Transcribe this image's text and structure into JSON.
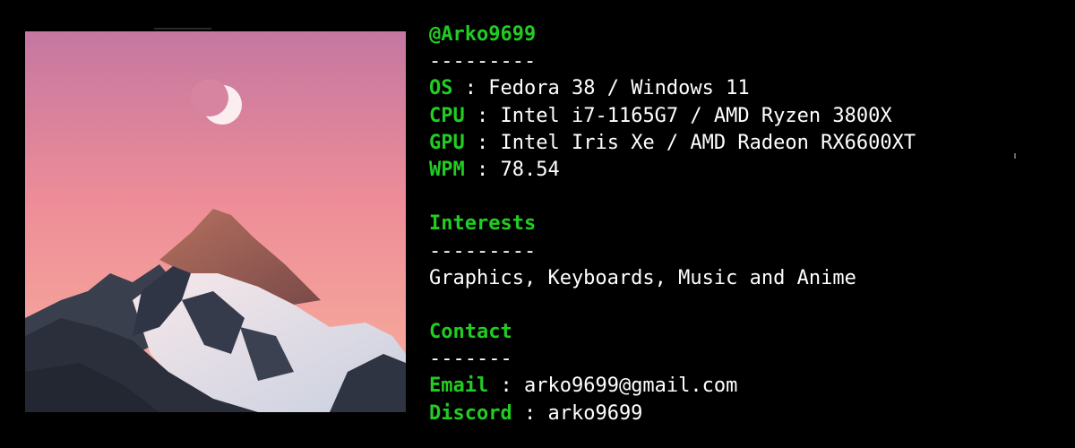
{
  "profile": {
    "handle": "@Arko9699",
    "handle_rule": "---------"
  },
  "specs": [
    {
      "key": "OS",
      "sep": " : ",
      "value": "Fedora 38 / Windows 11"
    },
    {
      "key": "CPU",
      "sep": " : ",
      "value": "Intel i7-1165G7 / AMD Ryzen 3800X"
    },
    {
      "key": "GPU",
      "sep": " : ",
      "value": "Intel Iris Xe / AMD Radeon RX6600XT"
    },
    {
      "key": "WPM",
      "sep": " : ",
      "value": "78.54"
    }
  ],
  "interests": {
    "heading": "Interests",
    "rule": "---------",
    "text": "Graphics, Keyboards, Music and Anime"
  },
  "contact": {
    "heading": "Contact",
    "rule": "-------",
    "items": [
      {
        "key": "Email",
        "sep": " : ",
        "value": "arko9699@gmail.com"
      },
      {
        "key": "Discord",
        "sep": " : ",
        "value": "arko9699"
      }
    ]
  },
  "image": {
    "subject": "mountain-peak-with-crescent-moon",
    "sky_top": "#c97aa0",
    "sky_bottom": "#f4a49a",
    "rock": "#2e3440",
    "snow": "#eef0f6",
    "sunlit_rock": "#c9826e"
  },
  "colors": {
    "background": "#000000",
    "accent": "#22cc22",
    "text": "#ffffff"
  }
}
